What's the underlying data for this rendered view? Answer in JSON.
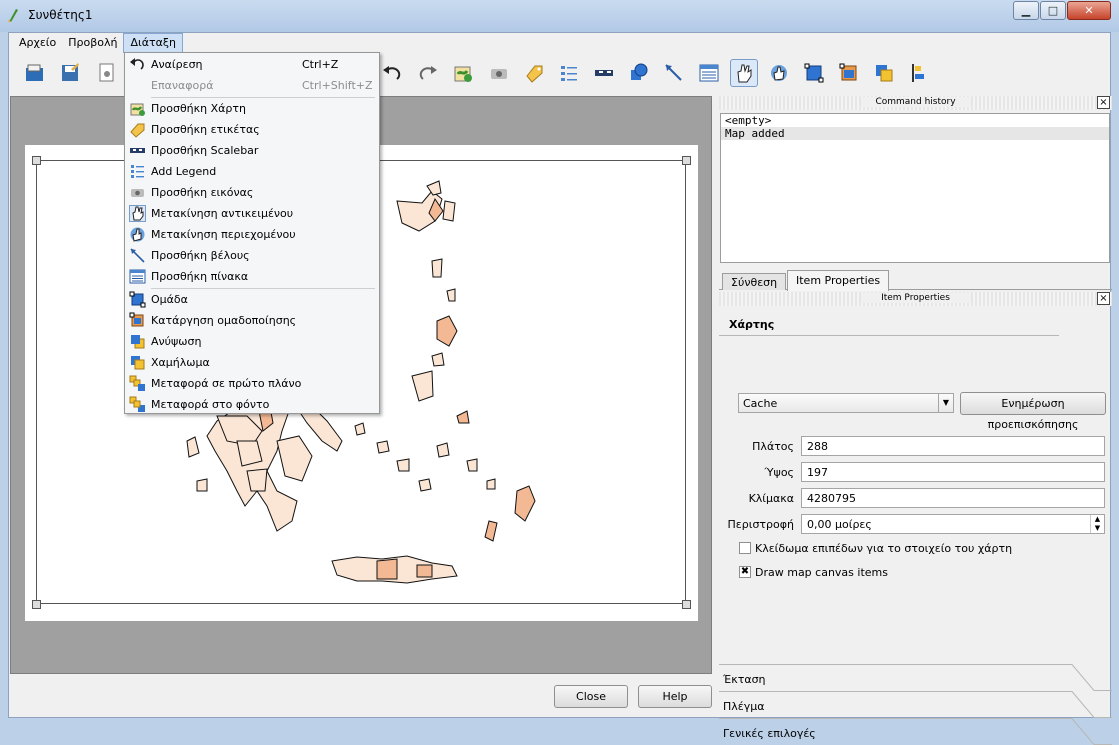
{
  "window": {
    "title": "Συνθέτης1",
    "minimize_glyph": "▁",
    "maximize_glyph": "□",
    "close_glyph": "✕"
  },
  "menubar": {
    "items": [
      "Αρχείο",
      "Προβολή",
      "Διάταξη"
    ],
    "active": "Διάταξη"
  },
  "toolbar": {
    "icons": [
      "open-template-icon",
      "save-template-icon",
      "new-composer-icon",
      "undo-icon",
      "redo-icon",
      "add-map-icon",
      "add-image-icon",
      "add-label-icon",
      "add-legend-icon",
      "add-scalebar-icon",
      "add-shape-icon",
      "add-arrow-icon",
      "add-table-icon",
      "select-move-item-icon",
      "move-item-content-icon",
      "group-items-icon",
      "ungroup-items-icon",
      "raise-items-icon",
      "align-items-icon"
    ],
    "active_tool": "select-move-item-icon"
  },
  "layout_menu": {
    "items": [
      {
        "label": "Αναίρεση",
        "shortcut": "Ctrl+Z",
        "icon": "undo-icon",
        "enabled": true
      },
      {
        "label": "Επαναφορά",
        "shortcut": "Ctrl+Shift+Z",
        "icon": "redo-icon",
        "enabled": false
      },
      {
        "label": "Προσθήκη Χάρτη",
        "shortcut": "",
        "icon": "add-map-icon",
        "enabled": true
      },
      {
        "label": "Προσθήκη ετικέτας",
        "shortcut": "",
        "icon": "add-label-icon",
        "enabled": true
      },
      {
        "label": "Προσθήκη Scalebar",
        "shortcut": "",
        "icon": "add-scalebar-icon",
        "enabled": true
      },
      {
        "label": "Add Legend",
        "shortcut": "",
        "icon": "add-legend-icon",
        "enabled": true
      },
      {
        "label": "Προσθήκη εικόνας",
        "shortcut": "",
        "icon": "add-image-icon",
        "enabled": true
      },
      {
        "label": "Μετακίνηση αντικειμένου",
        "shortcut": "",
        "icon": "select-move-item-icon",
        "enabled": true
      },
      {
        "label": "Μετακίνηση περιεχομένου",
        "shortcut": "",
        "icon": "move-item-content-icon",
        "enabled": true
      },
      {
        "label": "Προσθήκη βέλους",
        "shortcut": "",
        "icon": "add-arrow-icon",
        "enabled": true
      },
      {
        "label": "Προσθήκη πίνακα",
        "shortcut": "",
        "icon": "add-table-icon",
        "enabled": true
      },
      {
        "label": "Ομάδα",
        "shortcut": "",
        "icon": "group-items-icon",
        "enabled": true
      },
      {
        "label": "Κατάργηση ομαδοποίησης",
        "shortcut": "",
        "icon": "ungroup-items-icon",
        "enabled": true
      },
      {
        "label": "Ανύψωση",
        "shortcut": "",
        "icon": "raise-items-icon",
        "enabled": true
      },
      {
        "label": "Χαμήλωμα",
        "shortcut": "",
        "icon": "lower-items-icon",
        "enabled": true
      },
      {
        "label": "Μεταφορά σε πρώτο πλάνο",
        "shortcut": "",
        "icon": "move-to-top-icon",
        "enabled": true
      },
      {
        "label": "Μεταφορά στο φόντο",
        "shortcut": "",
        "icon": "move-to-bottom-icon",
        "enabled": true
      }
    ]
  },
  "command_history": {
    "title": "Command history",
    "entries": [
      "<empty>",
      "Map added"
    ],
    "selected_index": 1
  },
  "tabs": {
    "items": [
      "Σύνθεση",
      "Item Properties"
    ],
    "active": "Item Properties"
  },
  "item_properties": {
    "title": "Item Properties",
    "section": "Χάρτης",
    "preview_mode": "Cache",
    "update_preview_label": "Ενημέρωση προεπισκόπησης",
    "width_label": "Πλάτος",
    "width_value": "288",
    "height_label": "Ύψος",
    "height_value": "197",
    "scale_label": "Κλίμακα",
    "scale_value": "4280795",
    "rotation_label": "Περιστροφή",
    "rotation_value": "0,00 μοίρες",
    "lock_layers_label": "Κλείδωμα επιπέδων για το στοιχείο του χάρτη",
    "lock_layers_checked": false,
    "draw_canvas_label": "Draw map canvas items",
    "draw_canvas_checked": true,
    "collapsed_sections": [
      "Έκταση",
      "Πλέγμα",
      "Γενικές επιλογές"
    ]
  },
  "footer": {
    "close_label": "Close",
    "help_label": "Help"
  },
  "colors": {
    "region_fill": "#fbe6d6",
    "region_fill_dark": "#f3b894",
    "menu_highlight": "#cde0f5"
  }
}
